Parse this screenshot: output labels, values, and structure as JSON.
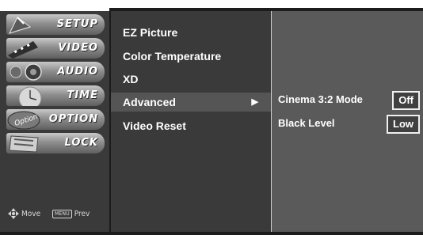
{
  "sidebar": {
    "categories": [
      {
        "label": "SETUP"
      },
      {
        "label": "VIDEO"
      },
      {
        "label": "AUDIO"
      },
      {
        "label": "TIME"
      },
      {
        "label": "OPTION",
        "art_text": "Option"
      },
      {
        "label": "LOCK"
      }
    ],
    "hints": {
      "move_label": "Move",
      "menu_key": "MENU",
      "prev_label": "Prev"
    }
  },
  "video_menu": {
    "items": [
      {
        "label": "EZ Picture"
      },
      {
        "label": "Color Temperature"
      },
      {
        "label": "XD"
      },
      {
        "label": "Advanced",
        "selected": true,
        "arrow": "▶"
      },
      {
        "label": "Video Reset"
      }
    ]
  },
  "advanced_submenu": {
    "rows": [
      {
        "label": "Cinema 3:2 Mode",
        "value": "Off"
      },
      {
        "label": "Black Level",
        "value": "Low"
      }
    ]
  },
  "colors": {
    "panel_bg": "#3a3a3a",
    "submenu_bg": "#5a5a5a",
    "selected_bg": "#555555",
    "text": "#ffffff"
  }
}
